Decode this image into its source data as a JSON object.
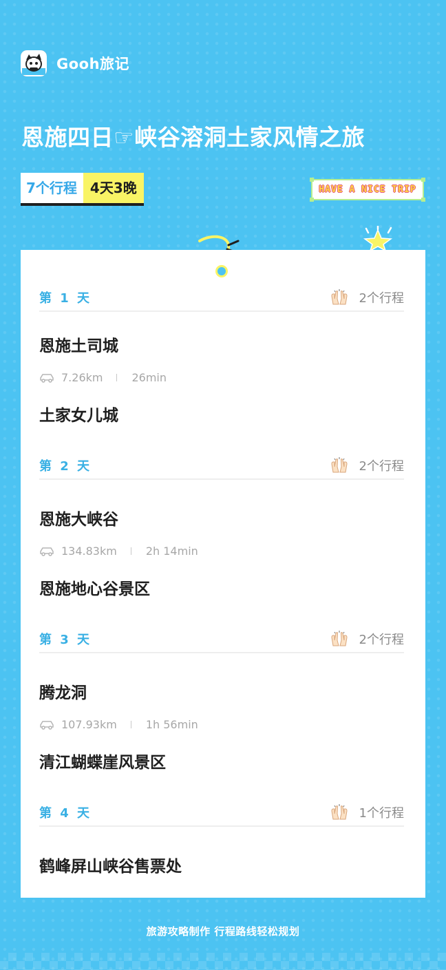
{
  "app": {
    "name": "Gooh旅记",
    "logo_icon": "mascot-logo-icon"
  },
  "title": "恩施四日☞峡谷溶洞土家风情之旅",
  "tags": {
    "trips": "7个行程",
    "duration": "4天3晚"
  },
  "badge": "HAVE A NICE TRIP",
  "days": [
    {
      "label": "第 1 天",
      "count": "2个行程",
      "places": [
        "恩施土司城",
        "土家女儿城"
      ],
      "route": {
        "distance": "7.26km",
        "time": "26min"
      }
    },
    {
      "label": "第 2 天",
      "count": "2个行程",
      "places": [
        "恩施大峡谷",
        "恩施地心谷景区"
      ],
      "route": {
        "distance": "134.83km",
        "time": "2h 14min"
      }
    },
    {
      "label": "第 3 天",
      "count": "2个行程",
      "places": [
        "腾龙洞",
        "清江蝴蝶崖风景区"
      ],
      "route": {
        "distance": "107.93km",
        "time": "1h 56min"
      }
    },
    {
      "label": "第 4 天",
      "count": "1个行程",
      "places": [
        "鹤峰屏山峡谷售票处"
      ]
    }
  ],
  "footer": "旅游攻略制作 行程路线轻松规划",
  "colors": {
    "background": "#4cc3f2",
    "accent_blue": "#39b0e4",
    "accent_yellow": "#f9f465"
  }
}
